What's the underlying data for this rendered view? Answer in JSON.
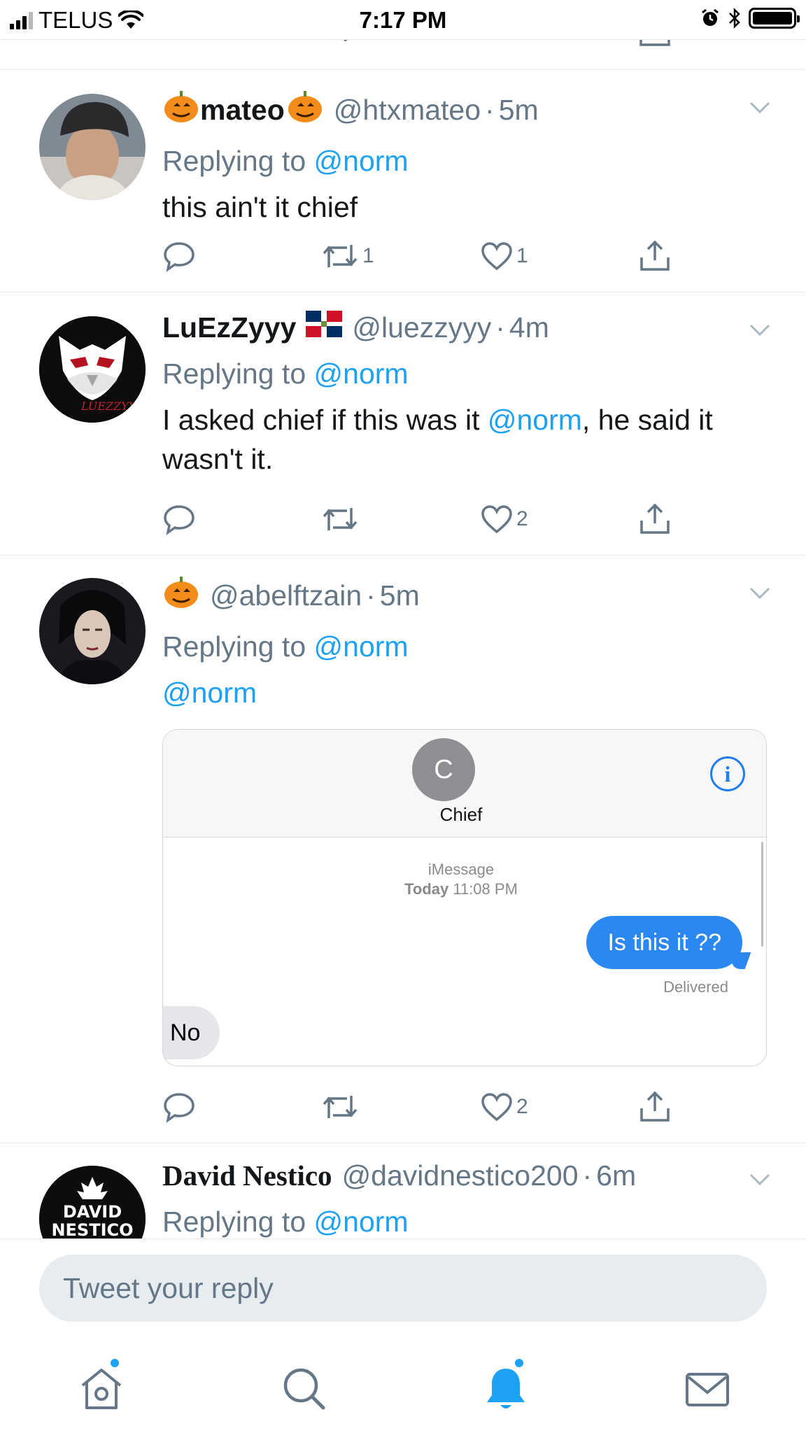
{
  "status_bar": {
    "carrier": "TELUS",
    "time": "7:17 PM"
  },
  "tweets": [
    {
      "name": "mateo",
      "handle": "@htxmateo",
      "time": "5m",
      "replying_prefix": "Replying to",
      "replying_to": "@norm",
      "text": "this ain't it chief",
      "retweets": "1",
      "likes": "1"
    },
    {
      "name": "LuEzZyyy",
      "handle": "@luezzyyy",
      "time": "4m",
      "replying_prefix": "Replying to",
      "replying_to": "@norm",
      "text_before": "I asked chief if this was it ",
      "text_mention": "@norm",
      "text_after": ", he said it wasn't it.",
      "avatar_text": "LUEZZYYY",
      "retweets": "",
      "likes": "2"
    },
    {
      "name": "",
      "handle": "@abelftzain",
      "time": "5m",
      "replying_prefix": "Replying to",
      "replying_to": "@norm",
      "text_mention": "@norm",
      "retweets": "",
      "likes": "2",
      "embed": {
        "contact_initial": "C",
        "contact_name": "Chief",
        "service": "iMessage",
        "timestamp_day": "Today",
        "timestamp_time": "11:08 PM",
        "outgoing": "Is this it ??",
        "status": "Delivered",
        "incoming": "No"
      }
    },
    {
      "name": "David Nestico",
      "handle": "@davidnestico200",
      "time": "6m",
      "replying_prefix": "Replying to",
      "replying_to": "@norm",
      "avatar_line1": "DAVID",
      "avatar_line2": "NESTICO"
    }
  ],
  "reply_bar": {
    "placeholder": "Tweet your reply"
  },
  "tabs": [
    "home",
    "search",
    "notifications",
    "messages"
  ],
  "colors": {
    "accent": "#1da1f2",
    "muted": "#657786",
    "imessage_blue": "#2b88f0"
  }
}
